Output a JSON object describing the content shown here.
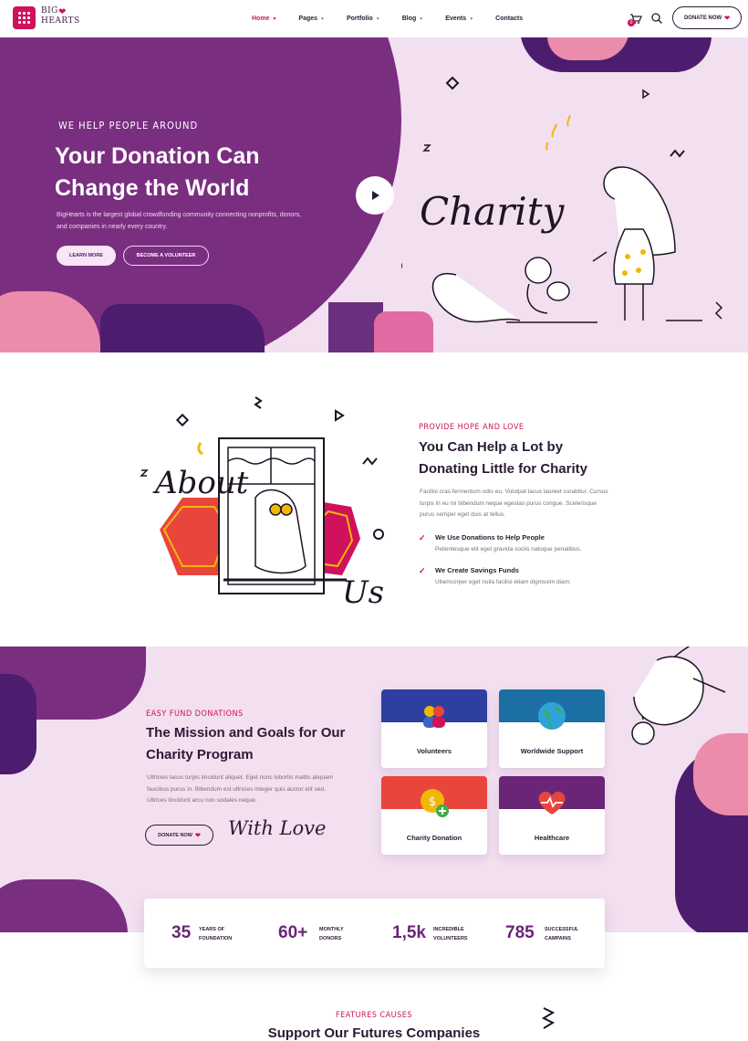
{
  "brand": {
    "logo_line1": "BIG",
    "logo_line2": "HEARTS",
    "accent": "#d0115b",
    "purple": "#7a2e80",
    "navy": "#4c1d6e",
    "pink_bg": "#f2dff0"
  },
  "nav": {
    "items": [
      {
        "label": "Home",
        "active": true,
        "has_dropdown": true
      },
      {
        "label": "Pages",
        "has_dropdown": true
      },
      {
        "label": "Portfolio",
        "has_dropdown": true
      },
      {
        "label": "Blog",
        "has_dropdown": true
      },
      {
        "label": "Events",
        "has_dropdown": true
      },
      {
        "label": "Contacts",
        "has_dropdown": false
      }
    ],
    "cart_count": "0",
    "donate_label": "DONATE NOW"
  },
  "hero": {
    "kicker": "WE HELP PEOPLE AROUND",
    "title": "Your Donation Can Change the World",
    "description": "BigHearts is the largest global crowdfunding community connecting nonprofits, donors, and companies in nearly every country.",
    "learn_more": "LEARN MORE",
    "volunteer": "BECOME A VOLUNTEER",
    "script_word": "Charity"
  },
  "about": {
    "script_word1": "About",
    "script_word2": "Us",
    "kicker": "PROVIDE HOPE AND LOVE",
    "title": "You Can Help a Lot by Donating Little for Charity",
    "description": "Facilisi cras fermentum odio eu. Volutpat lacus laoreet curabitur. Cursus turpis in eu mi bibendum neque egestas purus congue. Scelerisque purus semper eget duis at tellus.",
    "points": [
      {
        "title": "We Use Donations to Help People",
        "text": "Pellentesque elit eget gravida sociis natoque penatibus."
      },
      {
        "title": "We Create Savings Funds",
        "text": "Ullamcorper eget nulla facilisi etiam dignissim diam."
      }
    ]
  },
  "mission": {
    "kicker": "EASY FUND DONATIONS",
    "title": "The Mission and Goals for Our Charity Program",
    "description": "Ultricies lacus turpis tincidunt aliquet. Eget nunc lobortis mattis aliquam faucibus purus in. Bibendum est ultricies integer quis auctor elit sed. Ultrices tincidunt arcu non sodales neque.",
    "donate_label": "DONATE NOW",
    "script_text": "With Love",
    "cards": [
      {
        "label": "Volunteers",
        "icon": "people-icon"
      },
      {
        "label": "Worldwide Support",
        "icon": "globe-icon"
      },
      {
        "label": "Charity Donation",
        "icon": "coin-icon"
      },
      {
        "label": "Healthcare",
        "icon": "heart-pulse-icon"
      }
    ]
  },
  "stats": [
    {
      "value": "35",
      "label": "YEARS OF FOUNDATION"
    },
    {
      "value": "60+",
      "label": "MONTHLY DONORS"
    },
    {
      "value": "1,5k",
      "label": "INCREDIBLE VOLUNTEERS"
    },
    {
      "value": "785",
      "label": "SUCCESSFUL CAMPAINS"
    }
  ],
  "causes": {
    "kicker": "FEATURES CAUSES",
    "title": "Support Our Futures Companies"
  }
}
